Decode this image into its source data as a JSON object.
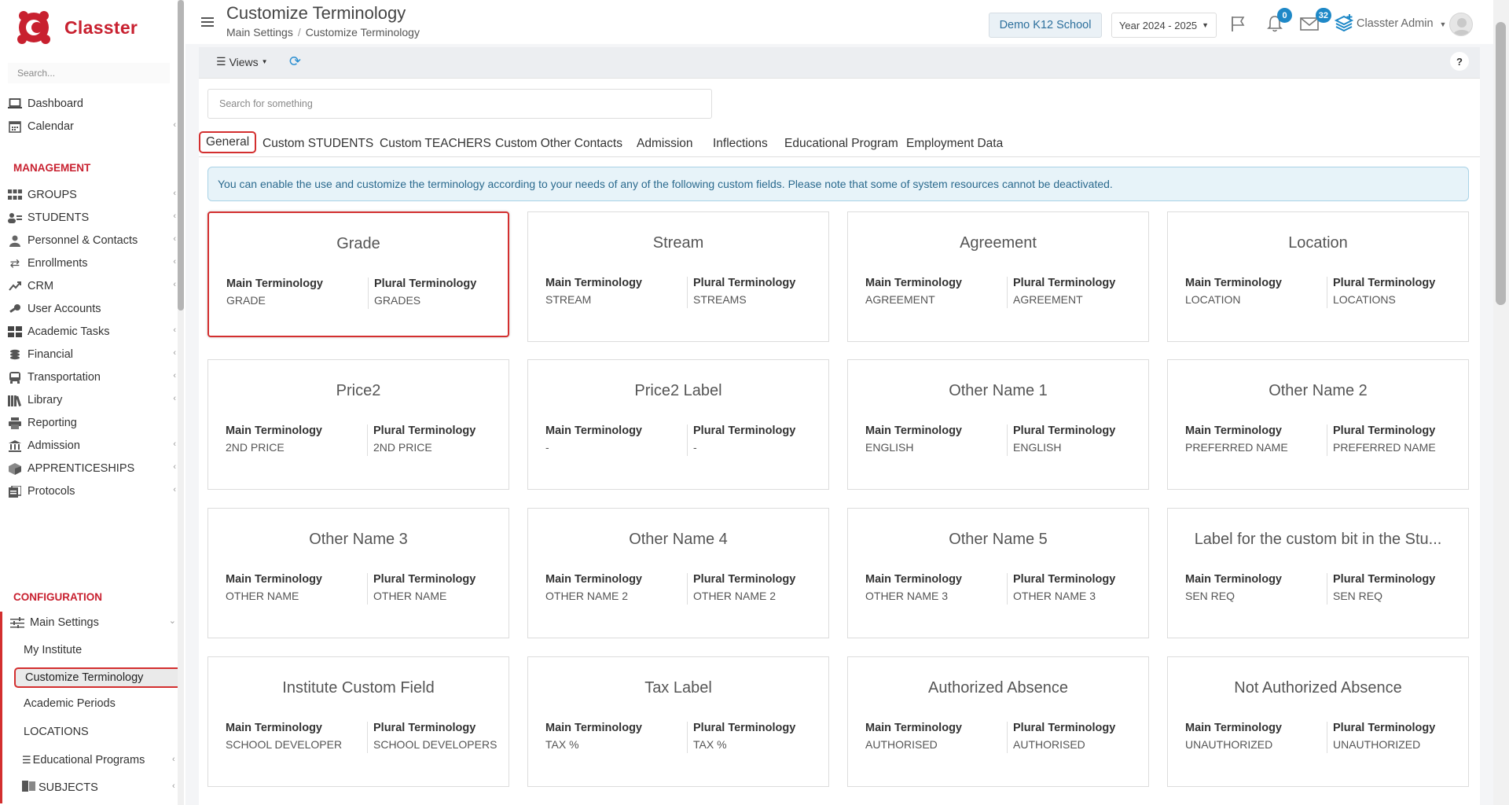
{
  "app": {
    "name": "Classter",
    "brand_color": "#c8202f",
    "accent_color": "#1e88c7"
  },
  "sidebar": {
    "search_placeholder": "Search...",
    "items": [
      {
        "label": "Dashboard",
        "icon": "laptop-icon",
        "chevron": false
      },
      {
        "label": "Calendar",
        "icon": "calendar-icon",
        "chevron": true
      }
    ],
    "management_header": "MANAGEMENT",
    "management_items": [
      {
        "label": "GROUPS",
        "icon": "groups-icon",
        "chevron": true
      },
      {
        "label": "STUDENTS",
        "icon": "students-icon",
        "chevron": true
      },
      {
        "label": "Personnel & Contacts",
        "icon": "person-icon",
        "chevron": true
      },
      {
        "label": "Enrollments",
        "icon": "swap-icon",
        "chevron": true
      },
      {
        "label": "CRM",
        "icon": "crm-icon",
        "chevron": true
      },
      {
        "label": "User Accounts",
        "icon": "key-icon",
        "chevron": false
      },
      {
        "label": "Academic Tasks",
        "icon": "grid-icon",
        "chevron": true
      },
      {
        "label": "Financial",
        "icon": "coins-icon",
        "chevron": true
      },
      {
        "label": "Transportation",
        "icon": "bus-icon",
        "chevron": true
      },
      {
        "label": "Library",
        "icon": "library-icon",
        "chevron": true
      },
      {
        "label": "Reporting",
        "icon": "printer-icon",
        "chevron": false
      },
      {
        "label": "Admission",
        "icon": "institution-icon",
        "chevron": true
      },
      {
        "label": "APPRENTICESHIPS",
        "icon": "cube-icon",
        "chevron": true
      },
      {
        "label": "Protocols",
        "icon": "protocols-icon",
        "chevron": true
      }
    ],
    "configuration_header": "CONFIGURATION",
    "main_settings_label": "Main Settings",
    "sub_items": {
      "my_institute": "My Institute",
      "customize_terminology": "Customize Terminology",
      "academic_periods": "Academic Periods",
      "locations": "LOCATIONS",
      "educational_programs": "Educational Programs",
      "subjects": "SUBJECTS"
    }
  },
  "header": {
    "title": "Customize Terminology",
    "breadcrumb": [
      "Main Settings",
      "Customize Terminology"
    ],
    "school": "Demo K12 School",
    "year": "Year 2024 - 2025",
    "notifications_count": "0",
    "messages_count": "32",
    "user_name": "Classter Admin"
  },
  "toolbar": {
    "views_label": "Views",
    "help_label": "?"
  },
  "main": {
    "search_placeholder": "Search for something",
    "tabs": [
      {
        "label": "General",
        "active": true
      },
      {
        "label": "Custom STUDENTS"
      },
      {
        "label": "Custom TEACHERS"
      },
      {
        "label": "Custom Other Contacts"
      },
      {
        "label": "Admission"
      },
      {
        "label": "Inflections"
      },
      {
        "label": "Educational Program"
      },
      {
        "label": "Employment Data"
      }
    ],
    "info_text": "You can enable the use and customize the terminology according to your needs of any of the following custom fields. Please note that some of system resources cannot be deactivated.",
    "main_label": "Main Terminology",
    "plural_label": "Plural Terminology",
    "cards": [
      {
        "title": "Grade",
        "main": "GRADE",
        "plural": "GRADES"
      },
      {
        "title": "Stream",
        "main": "STREAM",
        "plural": "STREAMS"
      },
      {
        "title": "Agreement",
        "main": "AGREEMENT",
        "plural": "AGREEMENT"
      },
      {
        "title": "Location",
        "main": "LOCATION",
        "plural": "LOCATIONS"
      },
      {
        "title": "Price2",
        "main": "2ND PRICE",
        "plural": "2ND PRICE"
      },
      {
        "title": "Price2 Label",
        "main": "-",
        "plural": "-"
      },
      {
        "title": "Other Name 1",
        "main": "ENGLISH",
        "plural": "ENGLISH"
      },
      {
        "title": "Other Name 2",
        "main": "PREFERRED NAME",
        "plural": "PREFERRED NAME"
      },
      {
        "title": "Other Name 3",
        "main": "OTHER NAME",
        "plural": "OTHER NAME"
      },
      {
        "title": "Other Name 4",
        "main": "OTHER NAME 2",
        "plural": "OTHER NAME 2"
      },
      {
        "title": "Other Name 5",
        "main": "OTHER NAME 3",
        "plural": "OTHER NAME 3"
      },
      {
        "title": "Label for the custom bit in the Stu...",
        "main": "SEN REQ",
        "plural": "SEN REQ"
      },
      {
        "title": "Institute Custom Field",
        "main": "SCHOOL DEVELOPER",
        "plural": "SCHOOL DEVELOPERS"
      },
      {
        "title": "Tax Label",
        "main": "TAX %",
        "plural": "TAX %"
      },
      {
        "title": "Authorized Absence",
        "main": "AUTHORISED",
        "plural": "AUTHORISED"
      },
      {
        "title": "Not Authorized Absence",
        "main": "UNAUTHORIZED",
        "plural": "UNAUTHORIZED"
      }
    ]
  }
}
